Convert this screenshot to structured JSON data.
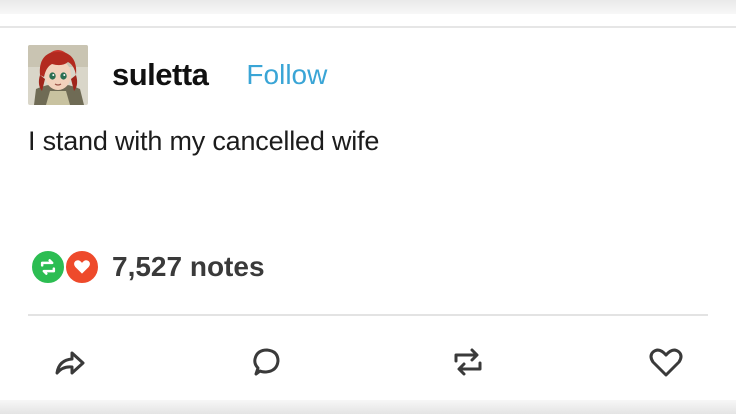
{
  "post": {
    "username": "suletta",
    "follow_label": "Follow",
    "body": "I stand with my cancelled wife",
    "notes": "7,527 notes"
  },
  "icons": {
    "avatar": "anime-character-avatar",
    "reblog_badge": "reblog-icon",
    "like_badge": "heart-icon",
    "share": "share-arrow-icon",
    "reply": "speech-bubble-icon",
    "reblog": "reblog-icon",
    "like": "heart-outline-icon"
  },
  "colors": {
    "follow": "#3aa5d6",
    "reblog_badge": "#2cbd52",
    "like_badge": "#ee4a2b"
  }
}
